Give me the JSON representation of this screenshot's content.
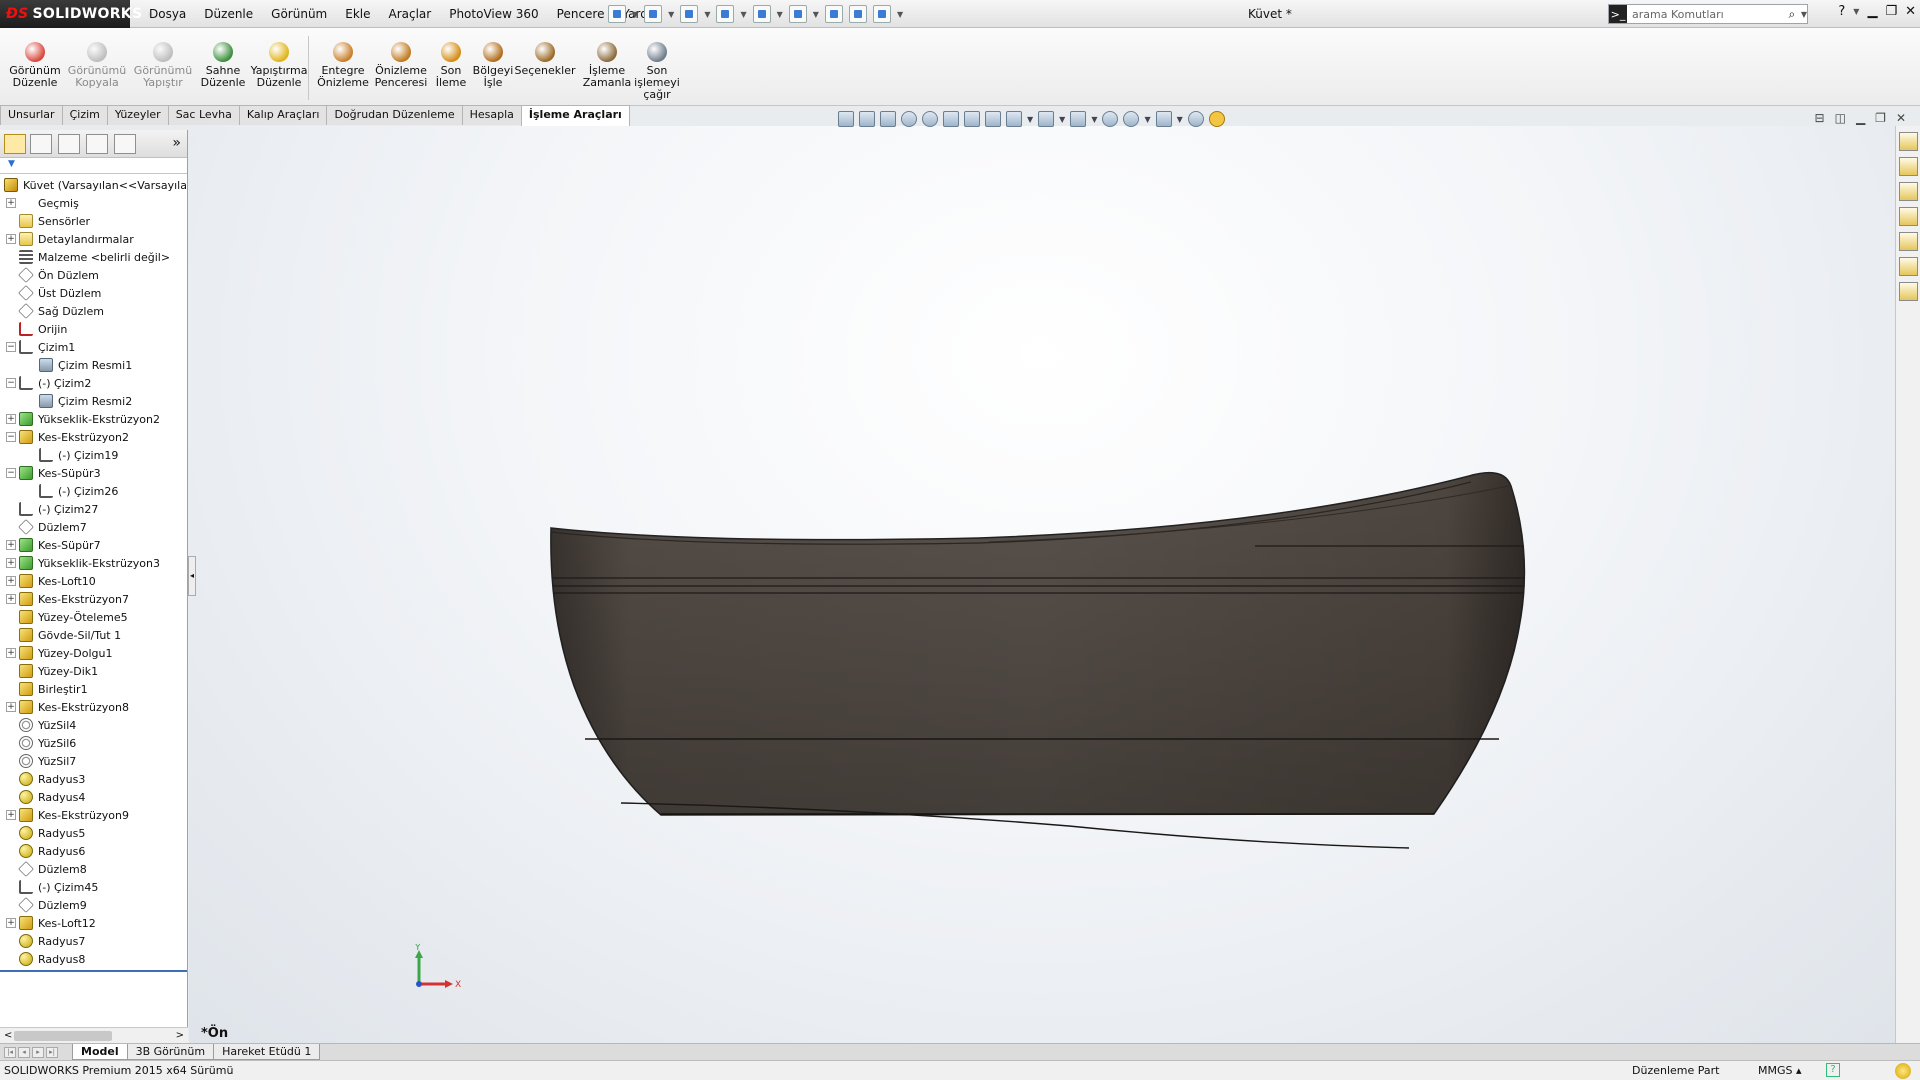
{
  "app": {
    "logo_text": "SOLIDWORKS",
    "document_title": "Küvet *",
    "search_placeholder": "arama Komutları",
    "menu": [
      "Dosya",
      "Düzenle",
      "Görünüm",
      "Ekle",
      "Araçlar",
      "PhotoView 360",
      "Pencere",
      "Yardım"
    ]
  },
  "ribbon": {
    "buttons": [
      {
        "label": "Görünüm\nDüzenle",
        "icon": "edit-appearance-icon",
        "enabled": true,
        "color": "#d9473c"
      },
      {
        "label": "Görünümü\nKopyala",
        "icon": "copy-appearance-icon",
        "enabled": false,
        "color": "#7a7a7a"
      },
      {
        "label": "Görünümü\nYapıştır",
        "icon": "paste-appearance-icon",
        "enabled": false,
        "color": "#7a7a7a"
      },
      {
        "label": "Sahne\nDüzenle",
        "icon": "edit-scene-icon",
        "enabled": true,
        "color": "#3b8f3b"
      },
      {
        "label": "Yapıştırma\nDüzenle",
        "icon": "edit-decal-icon",
        "enabled": true,
        "color": "#e0b418"
      },
      {
        "label": "Entegre\nÖnizleme",
        "icon": "integrated-preview-icon",
        "enabled": true,
        "color": "#c97e2a"
      },
      {
        "label": "Önizleme\nPenceresi",
        "icon": "preview-window-icon",
        "enabled": true,
        "color": "#c07a1c"
      },
      {
        "label": "Son\nİleme",
        "icon": "final-render-icon",
        "enabled": true,
        "color": "#d48c12"
      },
      {
        "label": "Bölgeyi\nİşle",
        "icon": "render-region-icon",
        "enabled": true,
        "color": "#b06d1a"
      },
      {
        "label": "Seçenekler",
        "icon": "options-icon",
        "enabled": true,
        "color": "#9a6a26"
      },
      {
        "label": "İşleme\nZamanla",
        "icon": "schedule-render-icon",
        "enabled": true,
        "color": "#8b6a3a"
      },
      {
        "label": "Son\nişlemeyi\nçağır",
        "icon": "recall-last-render-icon",
        "enabled": true,
        "color": "#6f7d8a"
      }
    ]
  },
  "tabs": [
    {
      "label": "Unsurlar",
      "active": false
    },
    {
      "label": "Çizim",
      "active": false
    },
    {
      "label": "Yüzeyler",
      "active": false
    },
    {
      "label": "Sac Levha",
      "active": false
    },
    {
      "label": "Kalıp Araçları",
      "active": false
    },
    {
      "label": "Doğrudan Düzenleme",
      "active": false
    },
    {
      "label": "Hesapla",
      "active": false
    },
    {
      "label": "İşleme Araçları",
      "active": true
    }
  ],
  "featuremanager": {
    "root": "Küvet  (Varsayılan<<Varsayılan>",
    "items": [
      {
        "label": "Geçmiş",
        "icon": "history",
        "expander": "+",
        "indent": 0
      },
      {
        "label": "Sensörler",
        "icon": "folder",
        "expander": "",
        "indent": 0
      },
      {
        "label": "Detaylandırmalar",
        "icon": "folder",
        "expander": "+",
        "indent": 0
      },
      {
        "label": "Malzeme <belirli değil>",
        "icon": "mat",
        "expander": "",
        "indent": 0
      },
      {
        "label": "Ön Düzlem",
        "icon": "plane",
        "expander": "",
        "indent": 0
      },
      {
        "label": "Üst Düzlem",
        "icon": "plane",
        "expander": "",
        "indent": 0
      },
      {
        "label": "Sağ Düzlem",
        "icon": "plane",
        "expander": "",
        "indent": 0
      },
      {
        "label": "Orijin",
        "icon": "origin",
        "expander": "",
        "indent": 0
      },
      {
        "label": "Çizim1",
        "icon": "sketch",
        "expander": "−",
        "indent": 0
      },
      {
        "label": "Çizim Resmi1",
        "icon": "img",
        "expander": "",
        "indent": 1
      },
      {
        "label": "(-) Çizim2",
        "icon": "sketch",
        "expander": "−",
        "indent": 0
      },
      {
        "label": "Çizim Resmi2",
        "icon": "img",
        "expander": "",
        "indent": 1
      },
      {
        "label": "Yükseklik-Ekstrüzyon2",
        "icon": "green",
        "expander": "+",
        "indent": 0
      },
      {
        "label": "Kes-Ekstrüzyon2",
        "icon": "feat",
        "expander": "−",
        "indent": 0
      },
      {
        "label": "(-) Çizim19",
        "icon": "sketch",
        "expander": "",
        "indent": 1
      },
      {
        "label": "Kes-Süpür3",
        "icon": "green",
        "expander": "−",
        "indent": 0
      },
      {
        "label": "(-) Çizim26",
        "icon": "sketch",
        "expander": "",
        "indent": 1
      },
      {
        "label": "(-) Çizim27",
        "icon": "sketch",
        "expander": "",
        "indent": 0
      },
      {
        "label": "Düzlem7",
        "icon": "plane",
        "expander": "",
        "indent": 0
      },
      {
        "label": "Kes-Süpür7",
        "icon": "green",
        "expander": "+",
        "indent": 0
      },
      {
        "label": "Yükseklik-Ekstrüzyon3",
        "icon": "green",
        "expander": "+",
        "indent": 0
      },
      {
        "label": "Kes-Loft10",
        "icon": "feat",
        "expander": "+",
        "indent": 0
      },
      {
        "label": "Kes-Ekstrüzyon7",
        "icon": "feat",
        "expander": "+",
        "indent": 0
      },
      {
        "label": "Yüzey-Öteleme5",
        "icon": "feat",
        "expander": "",
        "indent": 0
      },
      {
        "label": "Gövde-Sil/Tut 1",
        "icon": "feat",
        "expander": "",
        "indent": 0
      },
      {
        "label": "Yüzey-Dolgu1",
        "icon": "feat",
        "expander": "+",
        "indent": 0
      },
      {
        "label": "Yüzey-Dik1",
        "icon": "feat",
        "expander": "",
        "indent": 0
      },
      {
        "label": "Birleştir1",
        "icon": "feat",
        "expander": "",
        "indent": 0
      },
      {
        "label": "Kes-Ekstrüzyon8",
        "icon": "feat",
        "expander": "+",
        "indent": 0
      },
      {
        "label": "YüzSil4",
        "icon": "del",
        "expander": "",
        "indent": 0
      },
      {
        "label": "YüzSil6",
        "icon": "del",
        "expander": "",
        "indent": 0
      },
      {
        "label": "YüzSil7",
        "icon": "del",
        "expander": "",
        "indent": 0
      },
      {
        "label": "Radyus3",
        "icon": "fillet",
        "expander": "",
        "indent": 0
      },
      {
        "label": "Radyus4",
        "icon": "fillet",
        "expander": "",
        "indent": 0
      },
      {
        "label": "Kes-Ekstrüzyon9",
        "icon": "feat",
        "expander": "+",
        "indent": 0
      },
      {
        "label": "Radyus5",
        "icon": "fillet",
        "expander": "",
        "indent": 0
      },
      {
        "label": "Radyus6",
        "icon": "fillet",
        "expander": "",
        "indent": 0
      },
      {
        "label": "Düzlem8",
        "icon": "plane",
        "expander": "",
        "indent": 0
      },
      {
        "label": "(-) Çizim45",
        "icon": "sketch",
        "expander": "",
        "indent": 0
      },
      {
        "label": "Düzlem9",
        "icon": "plane",
        "expander": "",
        "indent": 0
      },
      {
        "label": "Kes-Loft12",
        "icon": "feat",
        "expander": "+",
        "indent": 0
      },
      {
        "label": "Radyus7",
        "icon": "fillet",
        "expander": "",
        "indent": 0
      },
      {
        "label": "Radyus8",
        "icon": "fillet",
        "expander": "",
        "indent": 0
      }
    ]
  },
  "viewport": {
    "view_label": "*Ön",
    "triad": {
      "x": "X",
      "y": "Y"
    },
    "model_color": "#4b443f"
  },
  "bottom_tabs": [
    {
      "label": "Model",
      "active": true
    },
    {
      "label": "3B Görünüm",
      "active": false
    },
    {
      "label": "Hareket Etüdü 1",
      "active": false
    }
  ],
  "status": {
    "version": "SOLIDWORKS Premium 2015 x64 Sürümü",
    "mode": "Düzenleme Part",
    "units": "MMGS"
  }
}
